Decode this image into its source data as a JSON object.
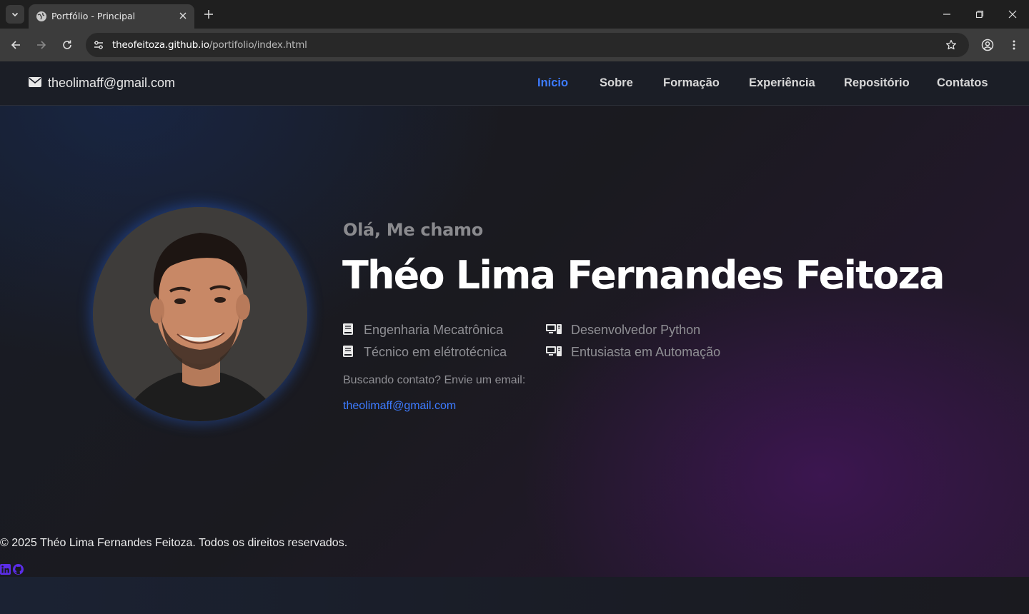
{
  "browser": {
    "tab_title": "Portfólio - Principal",
    "url_host": "theofeitoza.github.io",
    "url_path": "/portifolio/index.html"
  },
  "header": {
    "email": "theolimaff@gmail.com",
    "nav": [
      "Início",
      "Sobre",
      "Formação",
      "Experiência",
      "Repositório",
      "Contatos"
    ],
    "active_index": 0
  },
  "hero": {
    "greeting": "Olá, Me chamo",
    "name": "Théo Lima Fernandes Feitoza",
    "skills": [
      {
        "label": "Engenharia Mecatrônica",
        "icon": "book-icon"
      },
      {
        "label": "Técnico em elétrotécnica",
        "icon": "book-icon"
      },
      {
        "label": "Desenvolvedor Python",
        "icon": "computer-icon"
      },
      {
        "label": "Entusiasta em Automação",
        "icon": "computer-icon"
      }
    ],
    "contact_prompt": "Buscando contato? Envie um email:",
    "contact_email": "theolimaff@gmail.com"
  },
  "footer": {
    "copyright": "© 2025 Théo Lima Fernandes Feitoza. Todos os direitos reservados.",
    "social": [
      "linkedin-icon",
      "github-icon"
    ]
  },
  "colors": {
    "accent": "#3d7bff",
    "social": "#5b2de8",
    "text_muted": "#8f8f94"
  }
}
